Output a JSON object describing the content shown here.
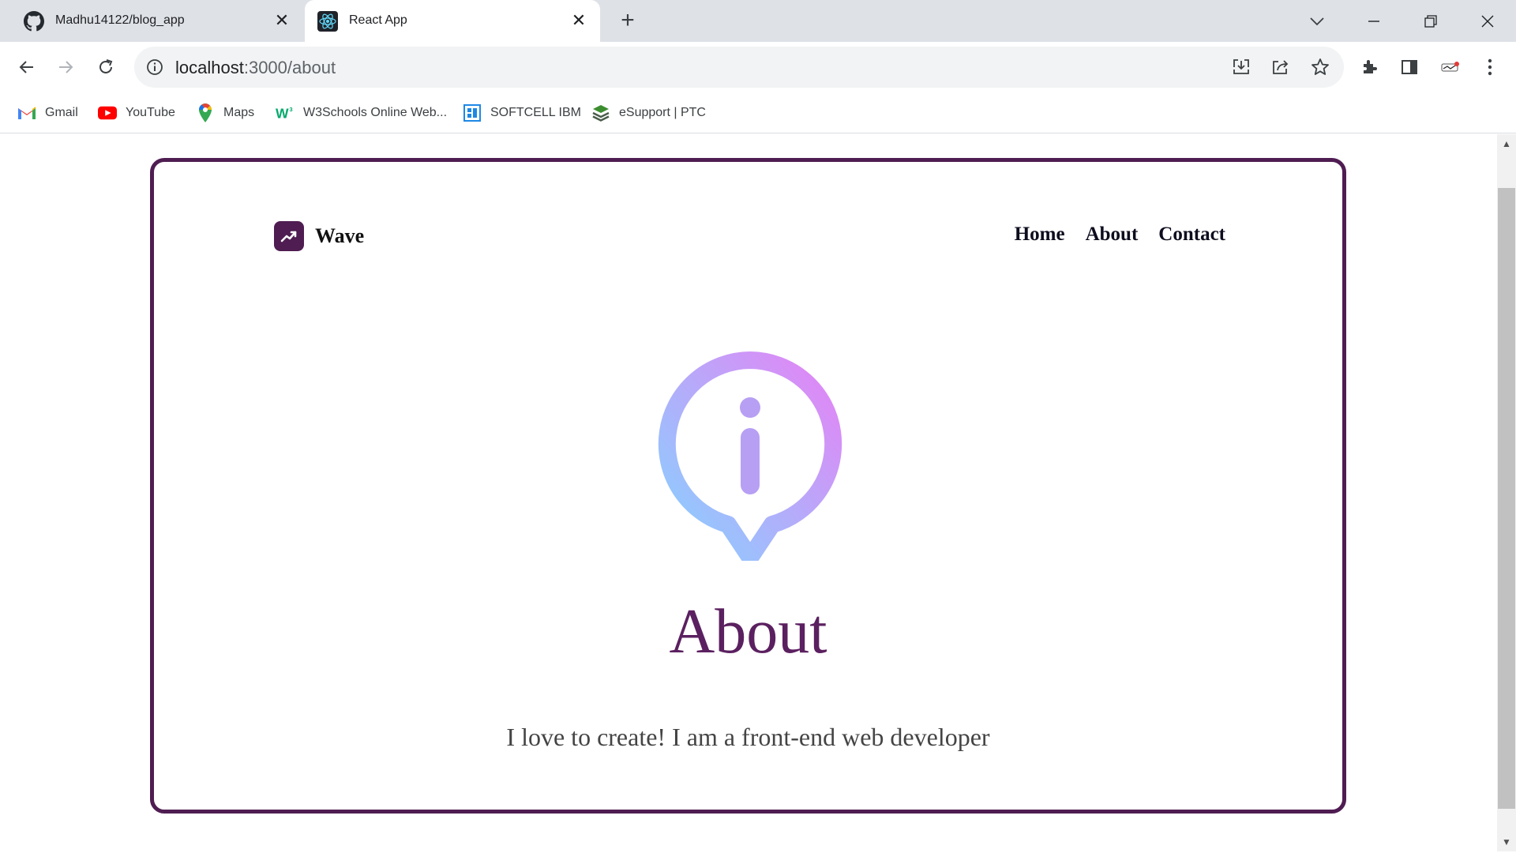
{
  "browser": {
    "tabs": [
      {
        "title": "Madhu14122/blog_app",
        "icon": "github-icon",
        "active": false
      },
      {
        "title": "React App",
        "icon": "react-icon",
        "active": true
      }
    ],
    "url_host": "localhost",
    "url_path": ":3000/about",
    "bookmarks": [
      {
        "label": "Gmail",
        "icon": "gmail-icon"
      },
      {
        "label": "YouTube",
        "icon": "youtube-icon"
      },
      {
        "label": "Maps",
        "icon": "maps-icon"
      },
      {
        "label": "W3Schools Online Web...",
        "icon": "w3schools-icon"
      },
      {
        "label": "SOFTCELL IBM",
        "icon": "softcell-icon"
      },
      {
        "label": "eSupport | PTC",
        "icon": "esupport-icon"
      }
    ]
  },
  "page": {
    "brand": "Wave",
    "nav": [
      "Home",
      "About",
      "Contact"
    ],
    "heading": "About",
    "tagline": "I love to create! I am a front-end web developer"
  },
  "colors": {
    "accent": "#4f1d52",
    "heading": "#5b2060",
    "gradient_start": "#86d3ff",
    "gradient_end": "#e583f5"
  }
}
